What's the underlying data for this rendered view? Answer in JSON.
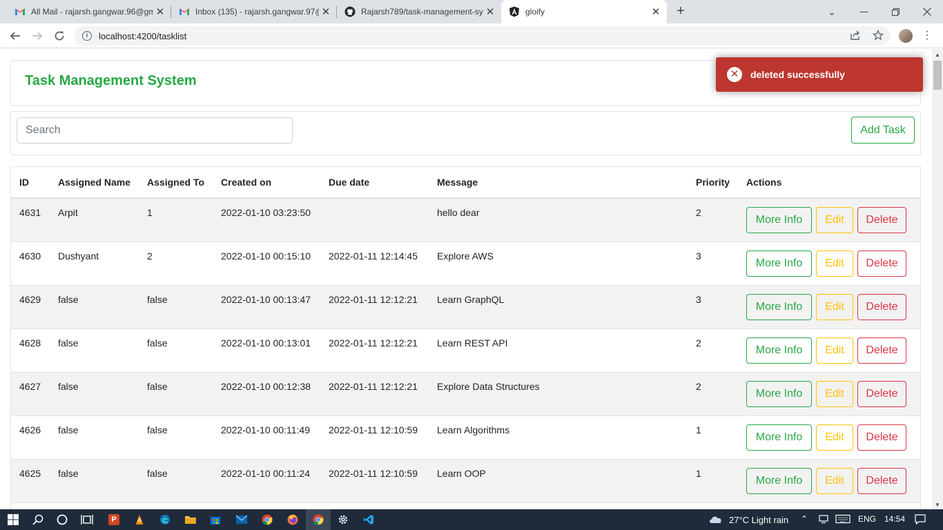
{
  "browser": {
    "tabs": [
      {
        "title": "All Mail - rajarsh.gangwar.96@gm",
        "favicon": "gmail-icon"
      },
      {
        "title": "Inbox (135) - rajarsh.gangwar.97@",
        "favicon": "gmail-icon"
      },
      {
        "title": "Rajarsh789/task-management-sy",
        "favicon": "github-icon"
      },
      {
        "title": "gloify",
        "favicon": "angular-icon"
      }
    ],
    "url": "localhost:4200/tasklist"
  },
  "page": {
    "app_title": "Task Management System",
    "search_placeholder": "Search",
    "add_task_label": "Add Task",
    "toast_message": "deleted successfully",
    "table": {
      "headers": [
        "ID",
        "Assigned Name",
        "Assigned To",
        "Created on",
        "Due date",
        "Message",
        "Priority",
        "Actions"
      ],
      "rows": [
        {
          "id": "4631",
          "name": "Arpit",
          "to": "1",
          "created": "2022-01-10 03:23:50",
          "due": "",
          "message": "hello dear",
          "priority": "2"
        },
        {
          "id": "4630",
          "name": "Dushyant",
          "to": "2",
          "created": "2022-01-10 00:15:10",
          "due": "2022-01-11 12:14:45",
          "message": "Explore AWS",
          "priority": "3"
        },
        {
          "id": "4629",
          "name": "false",
          "to": "false",
          "created": "2022-01-10 00:13:47",
          "due": "2022-01-11 12:12:21",
          "message": "Learn GraphQL",
          "priority": "3"
        },
        {
          "id": "4628",
          "name": "false",
          "to": "false",
          "created": "2022-01-10 00:13:01",
          "due": "2022-01-11 12:12:21",
          "message": "Learn REST API",
          "priority": "2"
        },
        {
          "id": "4627",
          "name": "false",
          "to": "false",
          "created": "2022-01-10 00:12:38",
          "due": "2022-01-11 12:12:21",
          "message": "Explore Data Structures",
          "priority": "2"
        },
        {
          "id": "4626",
          "name": "false",
          "to": "false",
          "created": "2022-01-10 00:11:49",
          "due": "2022-01-11 12:10:59",
          "message": "Learn Algorithms",
          "priority": "1"
        },
        {
          "id": "4625",
          "name": "false",
          "to": "false",
          "created": "2022-01-10 00:11:24",
          "due": "2022-01-11 12:10:59",
          "message": "Learn OOP",
          "priority": "1"
        }
      ],
      "action_labels": {
        "info": "More Info",
        "edit": "Edit",
        "delete": "Delete"
      }
    }
  },
  "taskbar": {
    "weather": "27°C  Light rain",
    "language": "ENG",
    "time": "14:54"
  },
  "colors": {
    "brand_green": "#28a745",
    "edit_yellow": "#ffc107",
    "delete_red": "#dc3545",
    "toast_red": "#bd362f"
  }
}
